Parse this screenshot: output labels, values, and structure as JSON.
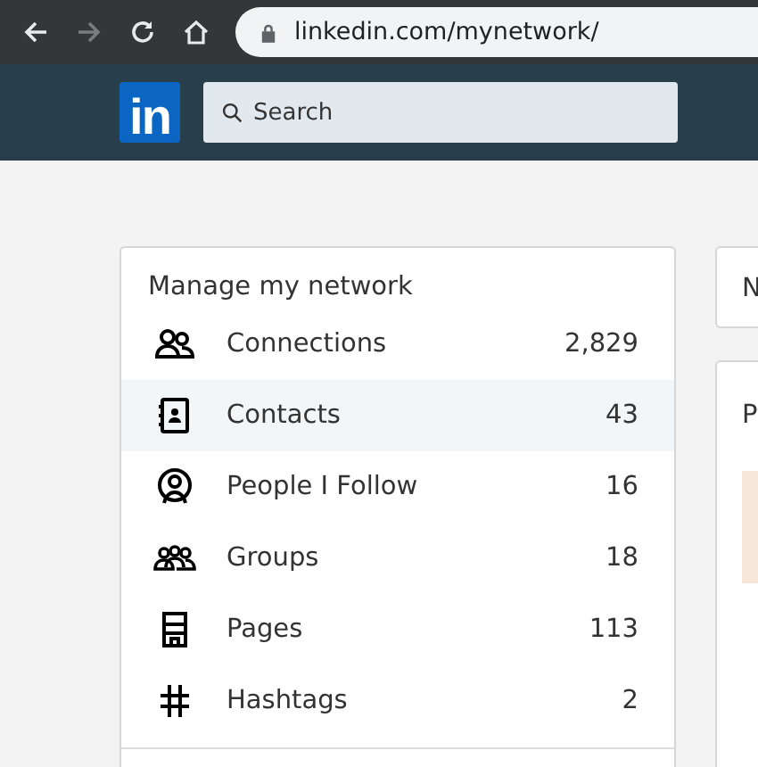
{
  "browser": {
    "url": "linkedin.com/mynetwork/"
  },
  "nav": {
    "logo": "in",
    "search": {
      "placeholder": "Search"
    }
  },
  "network_card": {
    "title": "Manage my network",
    "items": [
      {
        "label": "Connections",
        "count": "2,829",
        "selected": false
      },
      {
        "label": "Contacts",
        "count": "43",
        "selected": true
      },
      {
        "label": "People I Follow",
        "count": "16",
        "selected": false
      },
      {
        "label": "Groups",
        "count": "18",
        "selected": false
      },
      {
        "label": "Pages",
        "count": "113",
        "selected": false
      },
      {
        "label": "Hashtags",
        "count": "2",
        "selected": false
      }
    ]
  },
  "right_cards": [
    {
      "title": "N"
    },
    {
      "title": "P"
    }
  ]
}
